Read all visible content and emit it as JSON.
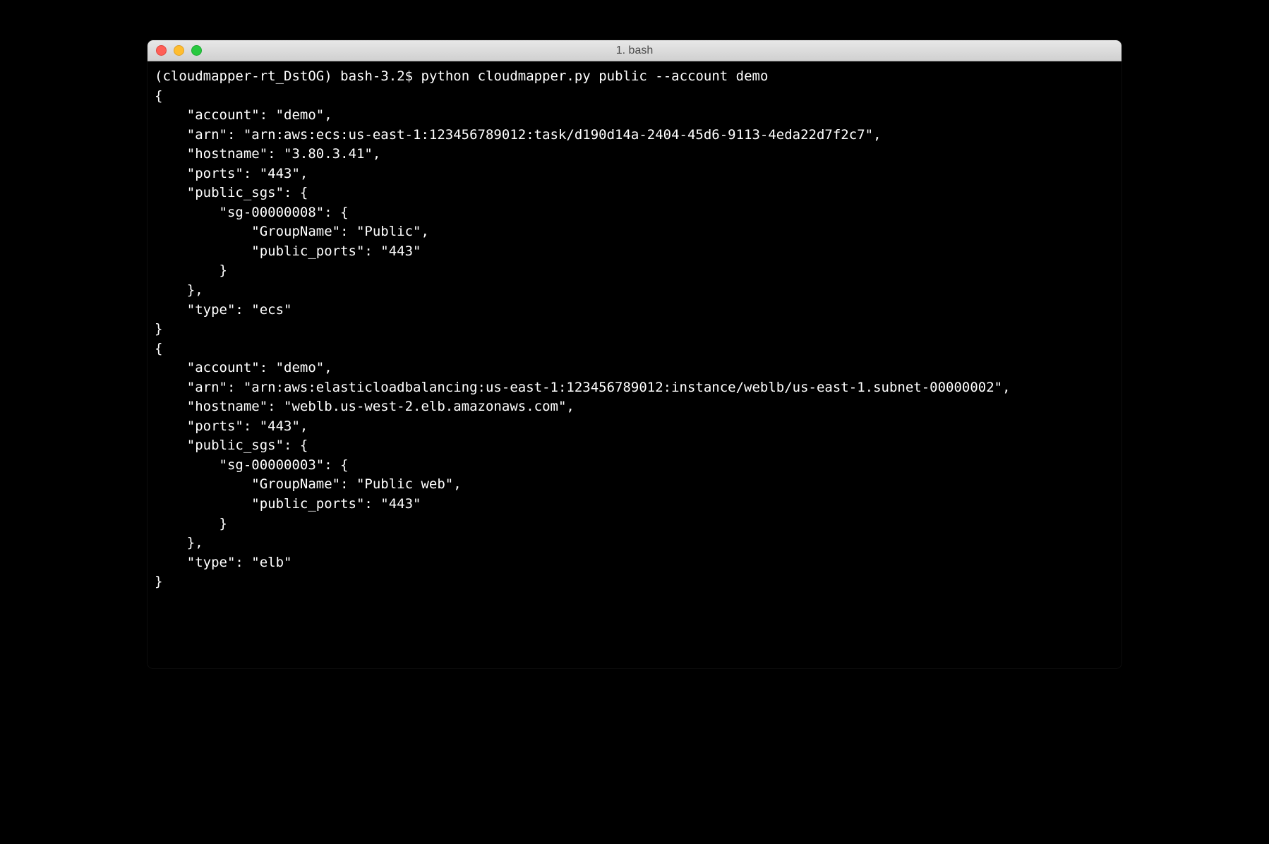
{
  "window": {
    "title": "1. bash"
  },
  "prompt": {
    "env": "(cloudmapper-rt_DstOG)",
    "shell": "bash-3.2$",
    "command": "python cloudmapper.py public --account demo"
  },
  "output_lines": [
    "{",
    "    \"account\": \"demo\",",
    "    \"arn\": \"arn:aws:ecs:us-east-1:123456789012:task/d190d14a-2404-45d6-9113-4eda22d7f2c7\",",
    "    \"hostname\": \"3.80.3.41\",",
    "    \"ports\": \"443\",",
    "    \"public_sgs\": {",
    "        \"sg-00000008\": {",
    "            \"GroupName\": \"Public\",",
    "            \"public_ports\": \"443\"",
    "        }",
    "    },",
    "    \"type\": \"ecs\"",
    "}",
    "{",
    "    \"account\": \"demo\",",
    "    \"arn\": \"arn:aws:elasticloadbalancing:us-east-1:123456789012:instance/weblb/us-east-1.subnet-00000002\",",
    "    \"hostname\": \"weblb.us-west-2.elb.amazonaws.com\",",
    "    \"ports\": \"443\",",
    "    \"public_sgs\": {",
    "        \"sg-00000003\": {",
    "            \"GroupName\": \"Public web\",",
    "            \"public_ports\": \"443\"",
    "        }",
    "    },",
    "    \"type\": \"elb\"",
    "}"
  ]
}
